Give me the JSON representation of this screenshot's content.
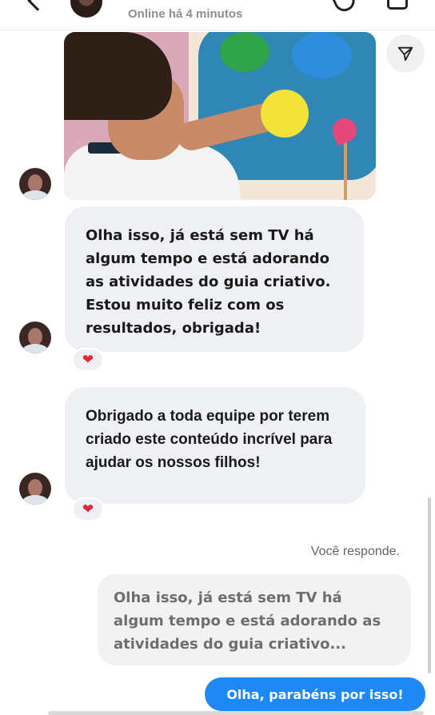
{
  "header": {
    "status": "Online há 4 minutos"
  },
  "icons": {
    "back": "chevron-left-icon",
    "call": "phone-icon",
    "video": "video-camera-icon",
    "share": "send-icon",
    "reaction": "heart-icon"
  },
  "messages": [
    {
      "text": "Olha isso, já está sem TV há algum tempo e está adorando as atividades do guia criativo. Estou muito feliz com os resultados, obrigada!",
      "reaction": "❤"
    },
    {
      "text": "Obrigado a toda equipe por terem criado este conteúdo incrível para ajudar os nossos filhos!",
      "reaction": "❤"
    }
  ],
  "reply": {
    "label": "Você responde.",
    "quoted_text": "Olha isso, já está sem TV há algum tempo e está adorando as atividades do guia criativo...",
    "sent_text": "Olha, parabéns por isso!"
  },
  "colors": {
    "sent_bubble": "#1e88f5",
    "received_bubble": "#eef0f3",
    "heart": "#e0283b"
  }
}
